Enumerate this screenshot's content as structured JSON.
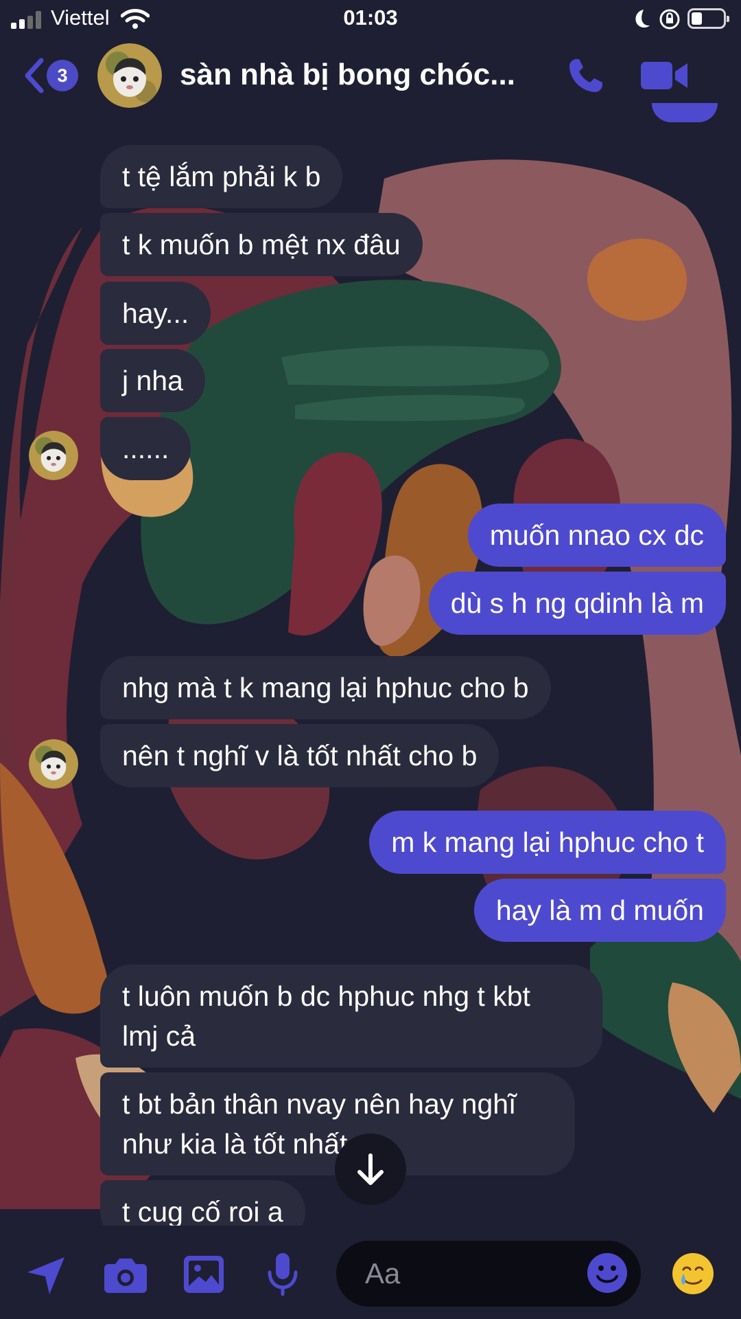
{
  "status": {
    "carrier": "Viettel",
    "time": "01:03"
  },
  "header": {
    "back_count": "3",
    "title": "sàn nhà bị bong chóc..."
  },
  "messages": [
    {
      "text": "t tệ lắm phải k b"
    },
    {
      "text": "t k muốn b mệt nx đâu"
    },
    {
      "text": "hay..."
    },
    {
      "text": "j nha"
    },
    {
      "text": "......"
    },
    {
      "text": "muốn nnao cx dc"
    },
    {
      "text": "dù s h ng qdinh là m"
    },
    {
      "text": "nhg mà t k mang lại hphuc cho b"
    },
    {
      "text": "nên t nghĩ v là tốt nhất cho b"
    },
    {
      "text": "m k mang lại hphuc cho t"
    },
    {
      "text": "hay là m d muốn"
    },
    {
      "line1": "t luôn muốn b dc hphuc nhg t kbt",
      "line2": "lmj cả"
    },
    {
      "line1": "t bt bản thân nvay nên hay nghĩ",
      "line2": "như kia là tốt nhất"
    },
    {
      "text": "t cug cố roi a"
    }
  ],
  "composer": {
    "placeholder": "Aa"
  },
  "icons": {
    "back": "chevron-left-icon",
    "call": "phone-icon",
    "video": "video-camera-icon",
    "scroll": "arrow-down-icon",
    "send": "send-arrow-icon",
    "camera": "camera-icon",
    "gallery": "image-icon",
    "mic": "microphone-icon",
    "emoji": "smiley-icon",
    "reaction": "crying-smile-emoji"
  },
  "colors": {
    "accent": "#4e4acf",
    "background": "#1e1f33",
    "incoming_bubble": "#2a2b3d",
    "badge": "#4c4ac5"
  }
}
